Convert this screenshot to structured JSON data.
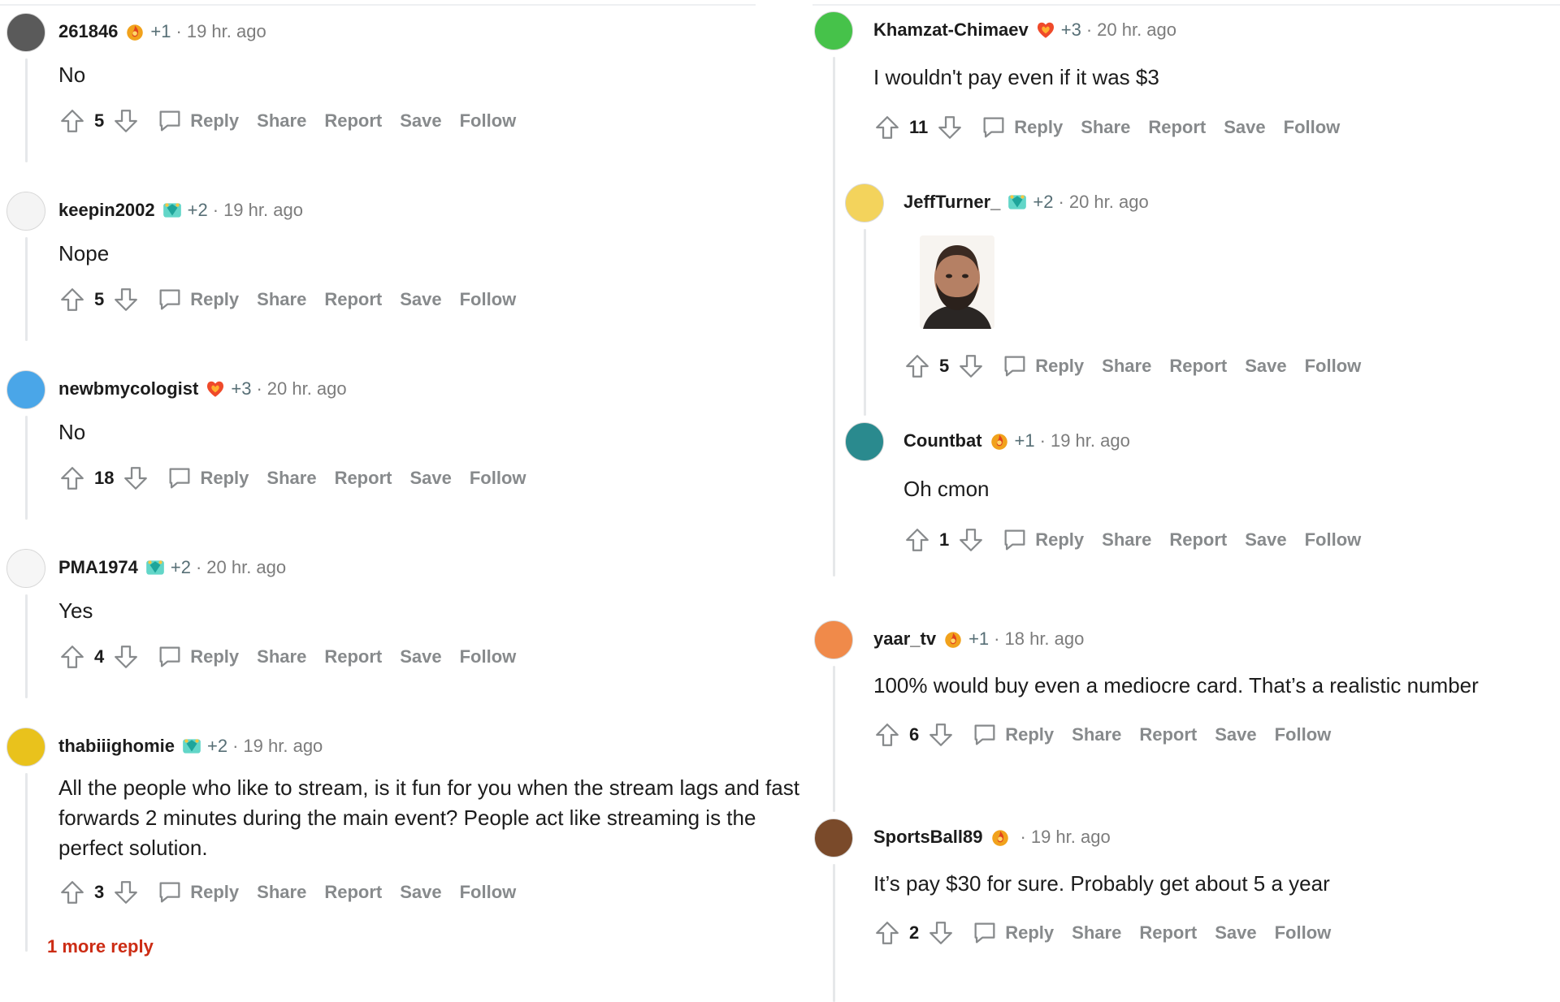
{
  "actions": {
    "reply": "Reply",
    "share": "Share",
    "report": "Report",
    "save": "Save",
    "follow": "Follow"
  },
  "left": [
    {
      "user": "261846",
      "award_count": "+1",
      "age": "19 hr. ago",
      "text": "No",
      "score": "5",
      "avatar_color": "#5a5a5a",
      "flair": "fire-award"
    },
    {
      "user": "keepin2002",
      "award_count": "+2",
      "age": "19 hr. ago",
      "text": "Nope",
      "score": "5",
      "avatar_color": "#f4f4f4",
      "flair": "gem-award"
    },
    {
      "user": "newbmycologist",
      "award_count": "+3",
      "age": "20 hr. ago",
      "text": "No",
      "score": "18",
      "avatar_color": "#4aa6e8",
      "flair": "heart-award"
    },
    {
      "user": "PMA1974",
      "award_count": "+2",
      "age": "20 hr. ago",
      "text": "Yes",
      "score": "4",
      "avatar_color": "#f6f6f6",
      "flair": "gem-award"
    },
    {
      "user": "thabiiighomie",
      "award_count": "+2",
      "age": "19 hr. ago",
      "text": "All the people who like to stream, is it fun for you when the stream lags and fast forwards 2 minutes during the main event? People act like streaming is the perfect solution.",
      "score": "3",
      "avatar_color": "#e9c21c",
      "flair": "gem-award"
    }
  ],
  "left_more_reply": "1 more reply",
  "right": [
    {
      "user": "Khamzat-Chimaev",
      "award_count": "+3",
      "age": "20 hr. ago",
      "text": "I wouldn't pay even if it was $3",
      "score": "11",
      "avatar_color": "#46c24a",
      "flair": "heart-award"
    },
    {
      "user": "JeffTurner_",
      "award_count": "+2",
      "age": "20 hr. ago",
      "text": "",
      "score": "5",
      "avatar_color": "#f3d35c",
      "flair": "gem-award"
    },
    {
      "user": "Countbat",
      "award_count": "+1",
      "age": "19 hr. ago",
      "text": "Oh cmon",
      "score": "1",
      "avatar_color": "#2a8a8e",
      "flair": "fire-award"
    },
    {
      "user": "yaar_tv",
      "award_count": "+1",
      "age": "18 hr. ago",
      "text": "100% would buy even a mediocre card. That’s a realistic number",
      "score": "6",
      "avatar_color": "#f08a4a",
      "flair": "fire-award"
    },
    {
      "user": "SportsBall89",
      "award_count": "",
      "age": "19 hr. ago",
      "text": "It’s pay $30 for sure. Probably get about 5 a year",
      "score": "2",
      "avatar_color": "#7a4a2a",
      "flair": "fire-award"
    }
  ],
  "colors": {
    "meta_gray": "#7c7c7c",
    "action_gray": "#878a8c",
    "more_reply_red": "#cc2c14",
    "thread_line": "#e6e8ea"
  }
}
